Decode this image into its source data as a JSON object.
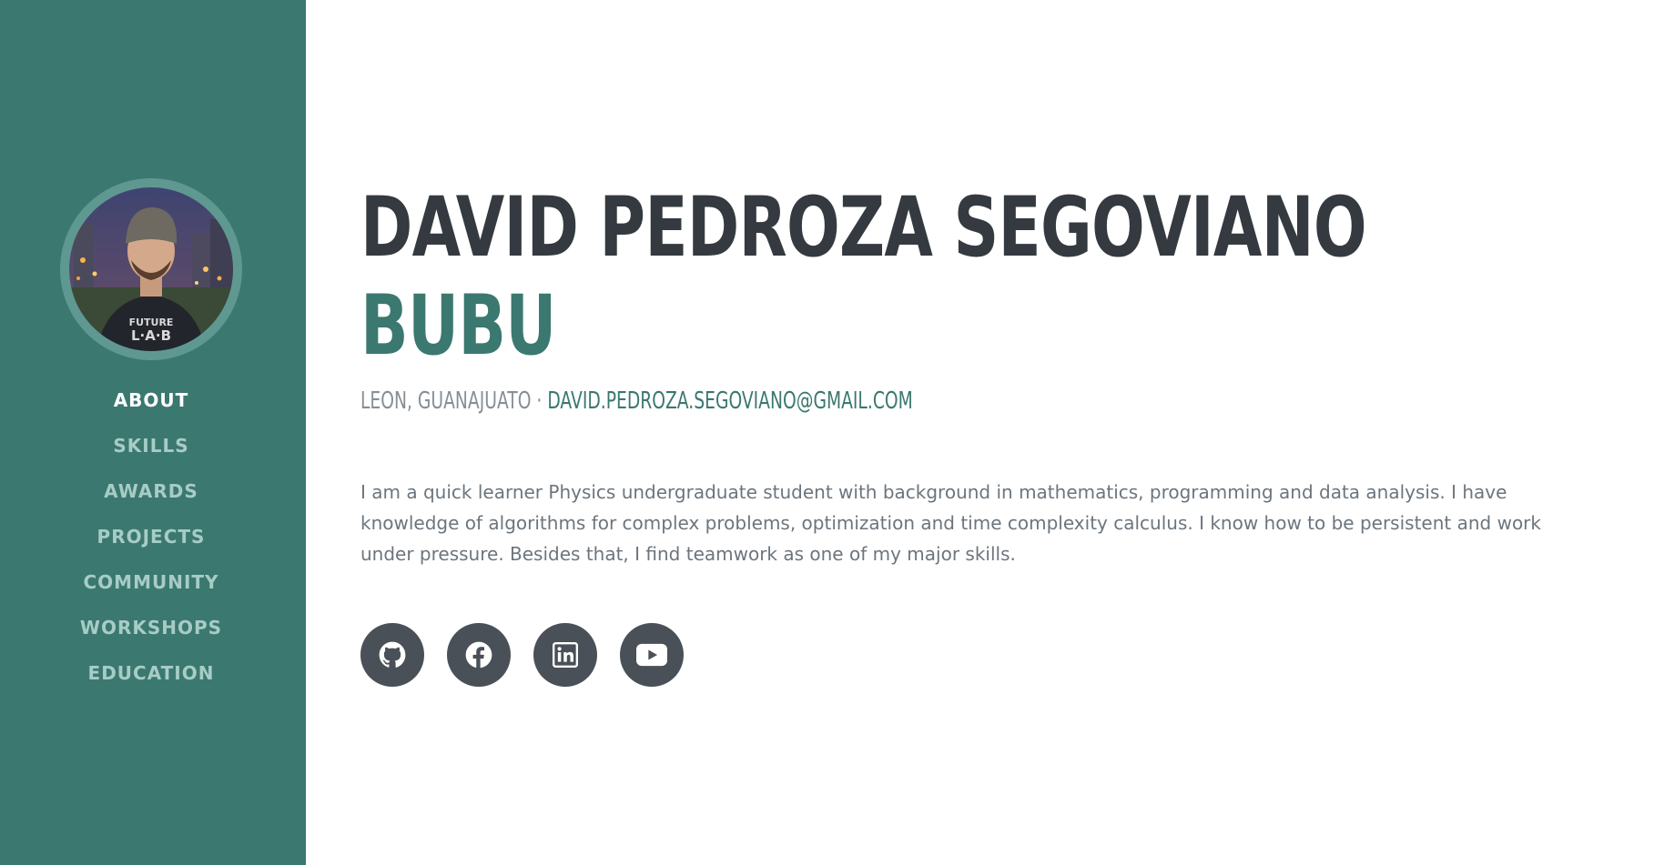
{
  "sidebar": {
    "nav": [
      {
        "label": "ABOUT",
        "active": true
      },
      {
        "label": "SKILLS",
        "active": false
      },
      {
        "label": "AWARDS",
        "active": false
      },
      {
        "label": "PROJECTS",
        "active": false
      },
      {
        "label": "COMMUNITY",
        "active": false
      },
      {
        "label": "WORKSHOPS",
        "active": false
      },
      {
        "label": "EDUCATION",
        "active": false
      }
    ],
    "avatar_icon": "profile-photo"
  },
  "about": {
    "first_name": "DAVID PEDROZA SEGOVIANO",
    "nickname": "BUBU",
    "location": "LEON, GUANAJUATO",
    "separator": " · ",
    "email": "DAVID.PEDROZA.SEGOVIANO@GMAIL.COM",
    "bio": "I am a quick learner Physics undergraduate student with background in mathematics, programming and data analysis. I have knowledge of algorithms for complex problems, optimization and time complexity calculus. I know how to be persistent and work under pressure. Besides that, I find teamwork as one of my major skills."
  },
  "social": [
    {
      "icon": "github-icon"
    },
    {
      "icon": "facebook-icon"
    },
    {
      "icon": "linkedin-icon"
    },
    {
      "icon": "youtube-icon"
    }
  ],
  "colors": {
    "sidebar_bg": "#3b7870",
    "accent": "#3b7870",
    "heading": "#343a40",
    "muted": "#868e96",
    "nav_inactive": "#a7ccc6",
    "social_bg": "#495057"
  }
}
